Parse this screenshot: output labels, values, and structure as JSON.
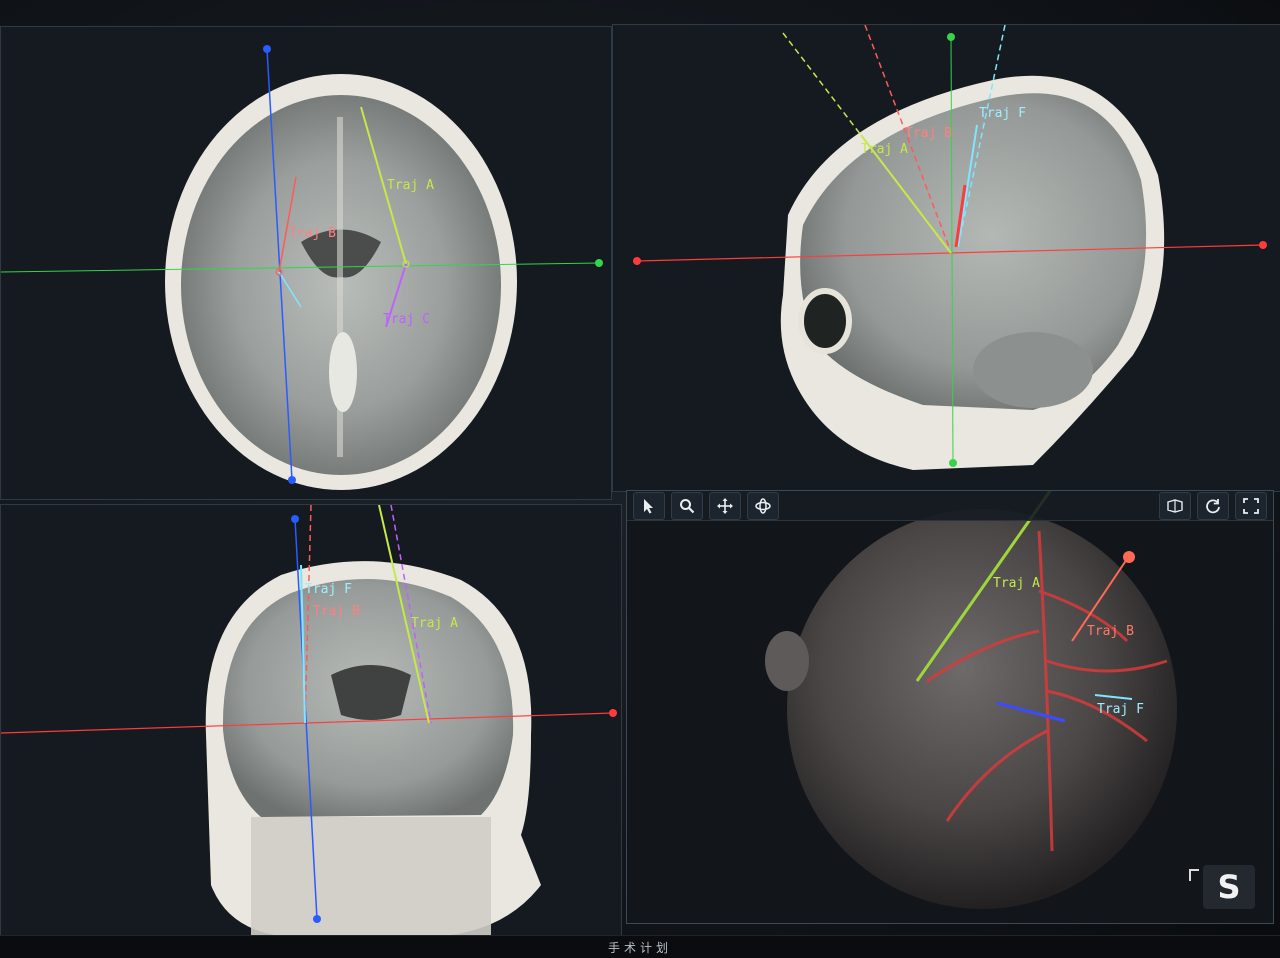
{
  "footer": {
    "title": "手术计划"
  },
  "viewports": {
    "axial": {
      "labels": {
        "traj_a": "Traj A",
        "traj_b": "Traj B",
        "traj_c": "Traj C"
      }
    },
    "sagittal": {
      "labels": {
        "traj_a": "Traj A",
        "traj_b": "Traj B",
        "traj_f": "Traj F"
      }
    },
    "coronal": {
      "labels": {
        "traj_a": "Traj A",
        "traj_b": "Traj B",
        "traj_f": "Traj F"
      }
    },
    "render3d": {
      "labels": {
        "traj_a": "Traj A",
        "traj_b": "Traj B",
        "traj_f": "Traj F"
      },
      "toolbar": [
        {
          "name": "pointer-tool",
          "icon": "arrow-cursor-icon"
        },
        {
          "name": "zoom-tool",
          "icon": "magnifier-icon"
        },
        {
          "name": "pan-tool",
          "icon": "move-arrows-icon"
        },
        {
          "name": "rotate-tool",
          "icon": "rotate-3d-icon"
        }
      ],
      "toolbar_right": [
        {
          "name": "view-mode-button",
          "icon": "cube-view-icon"
        },
        {
          "name": "reset-view-button",
          "icon": "refresh-icon"
        },
        {
          "name": "fullscreen-button",
          "icon": "fullscreen-icon"
        }
      ],
      "orientation_badge": "S"
    }
  },
  "colors": {
    "traj_a": "#c6e84a",
    "traj_b": "#ff5a5a",
    "traj_c": "#c060ff",
    "traj_f": "#7fe6ff",
    "crosshair_red": "#ff3b3b",
    "crosshair_green": "#35d44a",
    "crosshair_blue": "#2a5bff"
  }
}
